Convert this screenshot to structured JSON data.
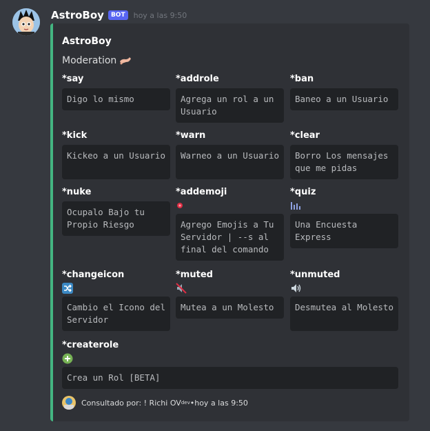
{
  "message": {
    "username": "AstroBoy",
    "bot_tag": "BOT",
    "timestamp": "hoy a las 9:50"
  },
  "embed": {
    "author": "AstroBoy",
    "description": "Moderation",
    "description_emoji": "leg-emoji",
    "accent_color": "#43b581",
    "fields": [
      {
        "name": "*say",
        "emoji": "",
        "value": "Digo lo mismo"
      },
      {
        "name": "*addrole",
        "emoji": "",
        "value": "Agrega un rol a un Usuario"
      },
      {
        "name": "*ban",
        "emoji": "",
        "value": "Baneo a un Usuario"
      },
      {
        "name": "*kick",
        "emoji": "",
        "value": "Kickeo a un Usuario"
      },
      {
        "name": "*warn",
        "emoji": "",
        "value": "Warneo a un Usuario"
      },
      {
        "name": "*clear",
        "emoji": "",
        "value": "Borro Los mensajes que me pidas"
      },
      {
        "name": "*nuke",
        "emoji": "",
        "value": "Ocupalo Bajo tu Propio Riesgo"
      },
      {
        "name": "*addemoji",
        "emoji": "red-circle-icon",
        "value": "Agrego Emojis a Tu Servidor | --s al final del comando"
      },
      {
        "name": "*quiz",
        "emoji": "chart-icon",
        "value": "Una Encuesta Express"
      },
      {
        "name": "*changeicon",
        "emoji": "shuffle-icon",
        "value": "Cambio el Icono del Servidor"
      },
      {
        "name": "*muted",
        "emoji": "muted-speaker-icon",
        "value": "Mutea a un Molesto"
      },
      {
        "name": "*unmuted",
        "emoji": "speaker-icon",
        "value": "Desmutea al Molesto"
      },
      {
        "name": "*createrole",
        "emoji": "plus-circle-icon",
        "value": "Crea un Rol [BETA]"
      }
    ],
    "footer": {
      "text": "Consultado por: ! Richi OV",
      "superscript": "dev",
      "separator": " • ",
      "time": "hoy a las 9:50"
    }
  }
}
